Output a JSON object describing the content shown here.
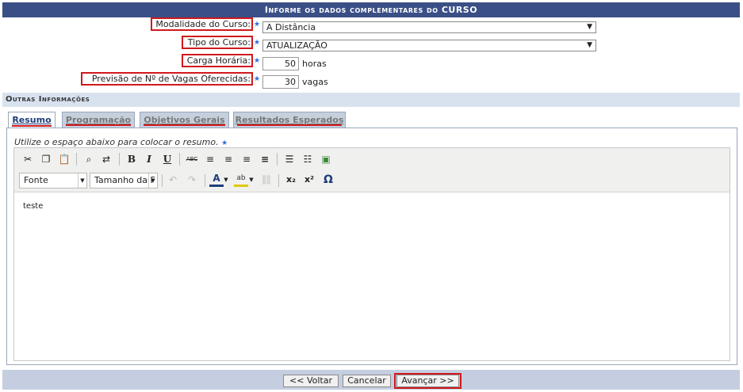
{
  "header": {
    "title": "Informe os dados complementares do CURSO"
  },
  "form": {
    "modalidade": {
      "label": "Modalidade do Curso:",
      "value": "A Distância"
    },
    "tipo": {
      "label": "Tipo do Curso:",
      "value": "ATUALIZAÇÃO"
    },
    "carga": {
      "label": "Carga Horária:",
      "value": "50",
      "unit": "horas"
    },
    "vagas": {
      "label": "Previsão de Nº de Vagas Oferecidas:",
      "value": "30",
      "unit": "vagas"
    }
  },
  "section": {
    "title": "Outras Informações"
  },
  "tabs": [
    {
      "label": "Resumo",
      "active": true
    },
    {
      "label": "Programação",
      "active": false
    },
    {
      "label": "Objetivos Gerais",
      "active": false
    },
    {
      "label": "Resultados Esperados",
      "active": false
    }
  ],
  "editor": {
    "hint": "Utilize o espaço abaixo para colocar o resumo.",
    "font_select": "Fonte",
    "size_select": "Tamanho da F",
    "content": "teste",
    "icons": {
      "bold": "B",
      "italic": "I",
      "underline": "U",
      "spell": "ABC",
      "subscript": "x₂",
      "superscript": "x²",
      "omega": "Ω",
      "font_color": "A",
      "highlight": "ab"
    }
  },
  "buttons": {
    "back": "<< Voltar",
    "cancel": "Cancelar",
    "next": "Avançar >>"
  },
  "colors": {
    "header_bg": "#3a4f86",
    "highlight": "#d0191d",
    "required": "#2f6fd8",
    "footer_bg": "#c4cee0"
  }
}
